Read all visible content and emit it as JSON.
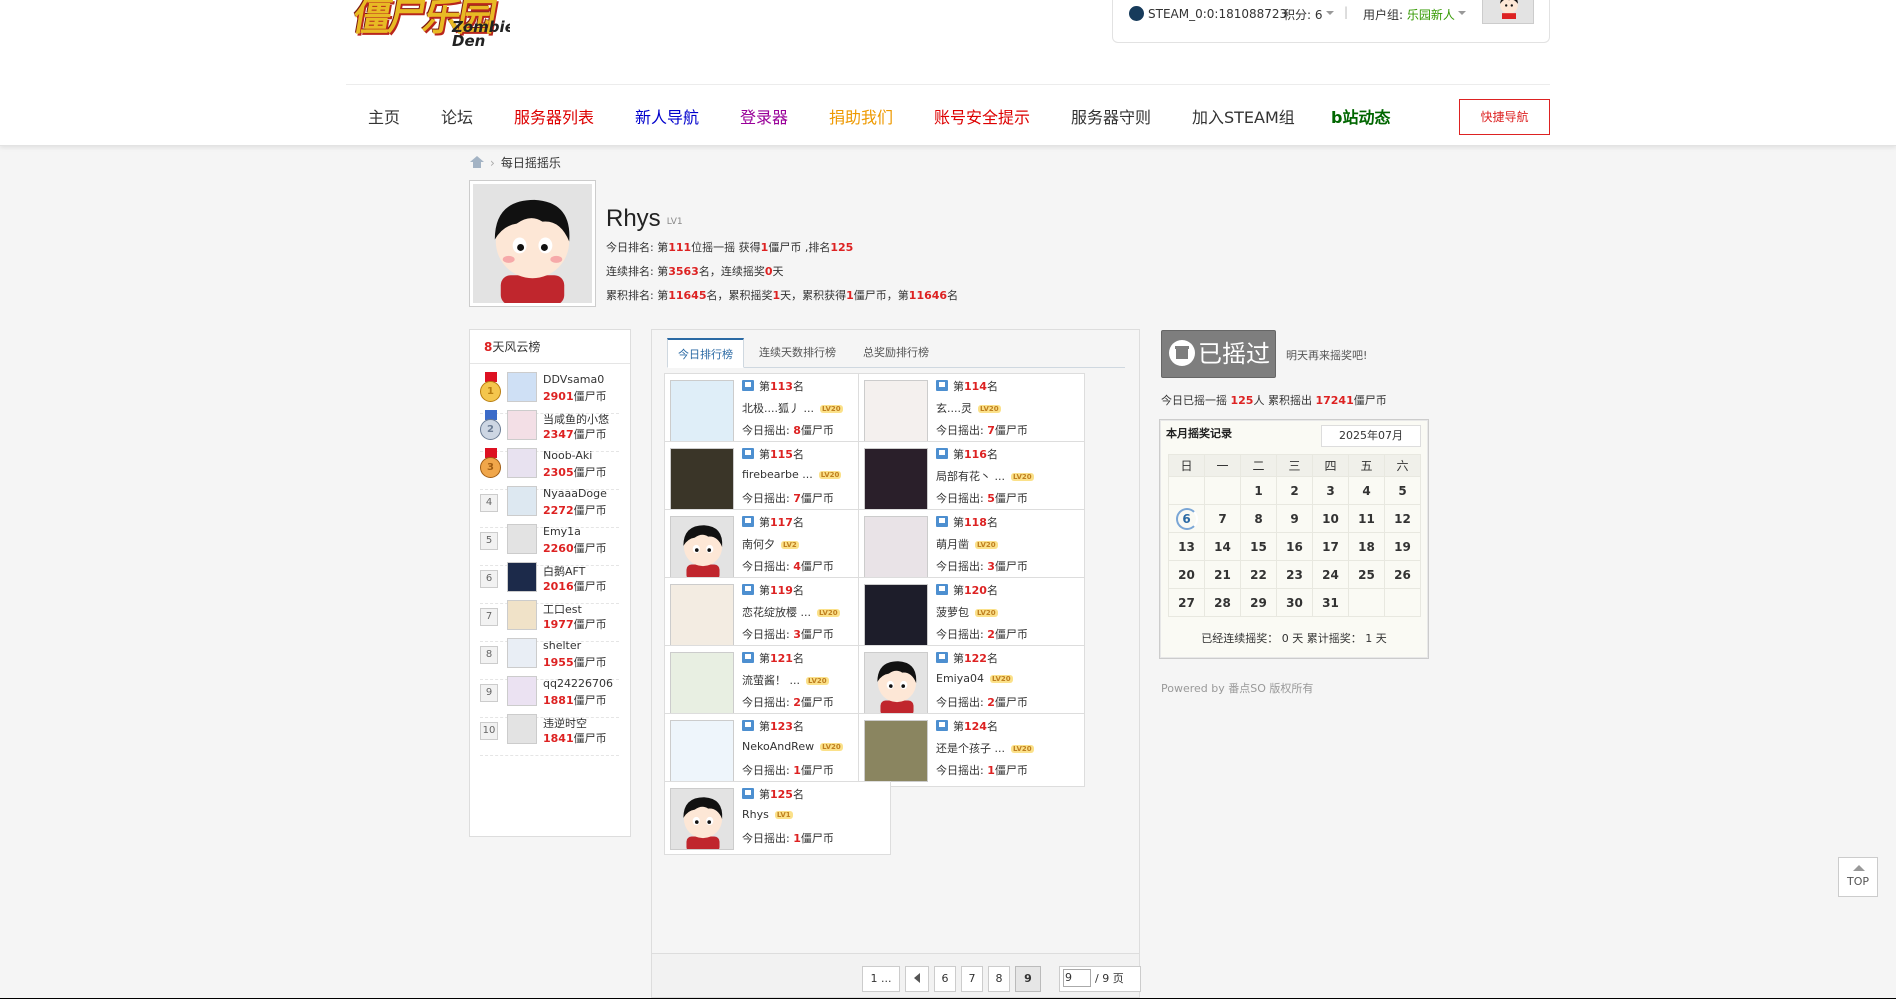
{
  "header": {
    "logo_text": "僵尸乐园",
    "logo_sub": "Zombie Den",
    "steam_id": "STEAM_0:0:181088723",
    "credit": "积分: 6",
    "group_label": "用户组:",
    "group_value": "乐园新人",
    "separator": "|"
  },
  "nav": {
    "items": [
      {
        "label": "主页",
        "color": "#333333"
      },
      {
        "label": "论坛",
        "color": "#333333"
      },
      {
        "label": "服务器列表",
        "color": "#dd0000"
      },
      {
        "label": "新人导航",
        "color": "#0000cc"
      },
      {
        "label": "登录器",
        "color": "#990099"
      },
      {
        "label": "捐助我们",
        "color": "#ee9900"
      },
      {
        "label": "账号安全提示",
        "color": "#dd0000"
      },
      {
        "label": "服务器守则",
        "color": "#333333"
      },
      {
        "label": "加入STEAM组",
        "color": "#333333"
      },
      {
        "label": "b站动态",
        "color": "#006600"
      }
    ],
    "quick": "快捷导航"
  },
  "breadcrumb": {
    "current": "每日摇摇乐",
    "arrow": "›"
  },
  "profile": {
    "name": "Rhys",
    "level": "LV1",
    "today": {
      "a": "今日排名: 第",
      "rank": "111",
      "b": "位摇一摇 获得",
      "coins": "1",
      "c": "僵尸币 ,排名",
      "rank2": "125"
    },
    "streak": {
      "a": "连续排名: 第",
      "rank": "3563",
      "b": "名，连续摇奖",
      "days": "0",
      "c": "天"
    },
    "total": {
      "a": "累积排名: 第",
      "rank": "11645",
      "b": "名，累积摇奖",
      "days": "1",
      "c": "天，累积获得",
      "coins": "1",
      "d": "僵尸币，第",
      "rank2": "11646",
      "e": "名"
    }
  },
  "leaderboard": {
    "title_num": "8",
    "title_text": "天风云榜",
    "unit": "僵尸币",
    "rows": [
      {
        "rank": "1",
        "name": "DDVsama0",
        "coins": "2901"
      },
      {
        "rank": "2",
        "name": "当咸鱼的小悠",
        "coins": "2347"
      },
      {
        "rank": "3",
        "name": "Noob-Aki",
        "coins": "2305"
      },
      {
        "rank": "4",
        "name": "NyaaaDoge",
        "coins": "2272"
      },
      {
        "rank": "5",
        "name": "Emy1a",
        "coins": "2260"
      },
      {
        "rank": "6",
        "name": "白鹅AFT",
        "coins": "2016"
      },
      {
        "rank": "7",
        "name": "工口est",
        "coins": "1977"
      },
      {
        "rank": "8",
        "name": "shelter",
        "coins": "1955"
      },
      {
        "rank": "9",
        "name": "qq24226706",
        "coins": "1881"
      },
      {
        "rank": "10",
        "name": "违逆时空",
        "coins": "1841"
      }
    ]
  },
  "tabs": [
    "今日排行榜",
    "连续天数排行榜",
    "总奖励排行榜"
  ],
  "cards": {
    "prefix": "第",
    "suffix": "名",
    "today_label": "今日摇出:",
    "unit": "僵尸币",
    "items": [
      {
        "rank": "113",
        "name": "北极....狐丿 ...",
        "coins": "8",
        "lv": "LV20"
      },
      {
        "rank": "114",
        "name": "玄....灵",
        "coins": "7",
        "lv": "LV20"
      },
      {
        "rank": "115",
        "name": "firebearbe ...",
        "coins": "7",
        "lv": "LV20"
      },
      {
        "rank": "116",
        "name": "局部有花丶 ...",
        "coins": "5",
        "lv": "LV20"
      },
      {
        "rank": "117",
        "name": "南何夕",
        "coins": "4",
        "lv": "LV2"
      },
      {
        "rank": "118",
        "name": "萌月凿",
        "coins": "3",
        "lv": "LV20"
      },
      {
        "rank": "119",
        "name": "恋花绽放樱 ...",
        "coins": "3",
        "lv": "LV20"
      },
      {
        "rank": "120",
        "name": "菠萝包",
        "coins": "2",
        "lv": "LV20"
      },
      {
        "rank": "121",
        "name": "流萤酱！ ...",
        "coins": "2",
        "lv": "LV20"
      },
      {
        "rank": "122",
        "name": "Emiya04",
        "coins": "2",
        "lv": "LV20"
      },
      {
        "rank": "123",
        "name": "NekoAndRew",
        "coins": "1",
        "lv": "LV20"
      },
      {
        "rank": "124",
        "name": "还是个孩子 ...",
        "coins": "1",
        "lv": "LV20"
      },
      {
        "rank": "125",
        "name": "Rhys",
        "coins": "1",
        "lv": "LV1"
      }
    ]
  },
  "pager": {
    "first": "1 ...",
    "pages": [
      "6",
      "7",
      "8",
      "9"
    ],
    "current": "9",
    "input": "9",
    "total": "/ 9 页"
  },
  "shake": {
    "button": "已摇过",
    "tomorrow": "明天再来摇奖吧!",
    "stat_a": "今日已摇一摇",
    "people": "125",
    "stat_b": "人 累积摇出",
    "coins": "17241",
    "stat_c": "僵尸币"
  },
  "calendar": {
    "title": "本月摇奖记录",
    "month": "2025年07月",
    "weekdays": [
      "日",
      "一",
      "二",
      "三",
      "四",
      "五",
      "六"
    ],
    "weeks": [
      [
        "",
        "",
        "1",
        "2",
        "3",
        "4",
        "5"
      ],
      [
        "6",
        "7",
        "8",
        "9",
        "10",
        "11",
        "12"
      ],
      [
        "13",
        "14",
        "15",
        "16",
        "17",
        "18",
        "19"
      ],
      [
        "20",
        "21",
        "22",
        "23",
        "24",
        "25",
        "26"
      ],
      [
        "27",
        "28",
        "29",
        "30",
        "31",
        "",
        ""
      ]
    ],
    "today": "6",
    "footer": "已经连续摇奖：  0 天  累计摇奖：  1 天"
  },
  "powered": "Powered by 番点SO 版权所有",
  "top_button": "TOP"
}
